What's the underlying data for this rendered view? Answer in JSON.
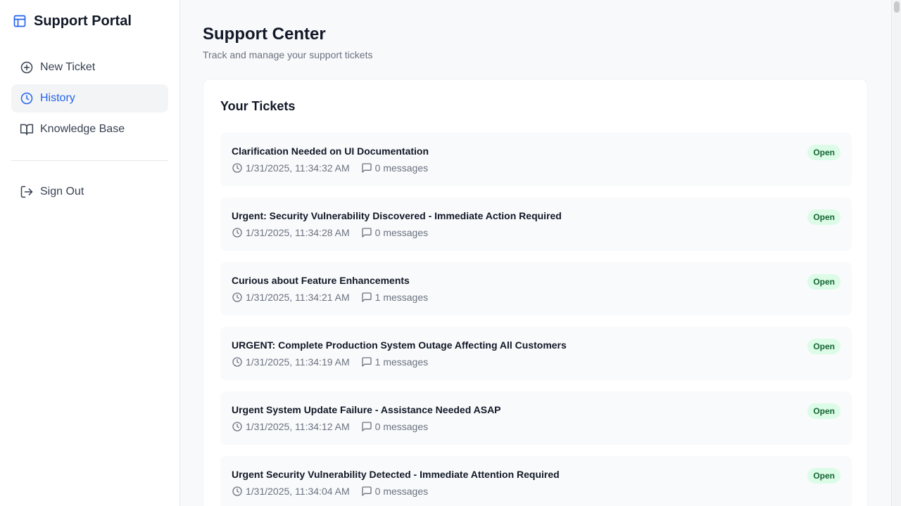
{
  "brand": {
    "title": "Support Portal",
    "accent": "#2563eb"
  },
  "nav": {
    "items": [
      {
        "label": "New Ticket",
        "icon": "plus-circle-icon",
        "active": false
      },
      {
        "label": "History",
        "icon": "clock-icon",
        "active": true
      },
      {
        "label": "Knowledge Base",
        "icon": "book-icon",
        "active": false
      }
    ],
    "sign_out": "Sign Out"
  },
  "header": {
    "title": "Support Center",
    "subtitle": "Track and manage your support tickets"
  },
  "tickets_card": {
    "title": "Your Tickets",
    "tickets": [
      {
        "title": "Clarification Needed on UI Documentation",
        "timestamp": "1/31/2025, 11:34:32 AM",
        "messages": "0 messages",
        "status": "Open"
      },
      {
        "title": "Urgent: Security Vulnerability Discovered - Immediate Action Required",
        "timestamp": "1/31/2025, 11:34:28 AM",
        "messages": "0 messages",
        "status": "Open"
      },
      {
        "title": "Curious about Feature Enhancements",
        "timestamp": "1/31/2025, 11:34:21 AM",
        "messages": "1 messages",
        "status": "Open"
      },
      {
        "title": "URGENT: Complete Production System Outage Affecting All Customers",
        "timestamp": "1/31/2025, 11:34:19 AM",
        "messages": "1 messages",
        "status": "Open"
      },
      {
        "title": "Urgent System Update Failure - Assistance Needed ASAP",
        "timestamp": "1/31/2025, 11:34:12 AM",
        "messages": "0 messages",
        "status": "Open"
      },
      {
        "title": "Urgent Security Vulnerability Detected - Immediate Attention Required",
        "timestamp": "1/31/2025, 11:34:04 AM",
        "messages": "0 messages",
        "status": "Open"
      }
    ]
  },
  "colors": {
    "status_open_bg": "#dcfce7",
    "status_open_text": "#166534",
    "active_nav": "#2563eb"
  }
}
